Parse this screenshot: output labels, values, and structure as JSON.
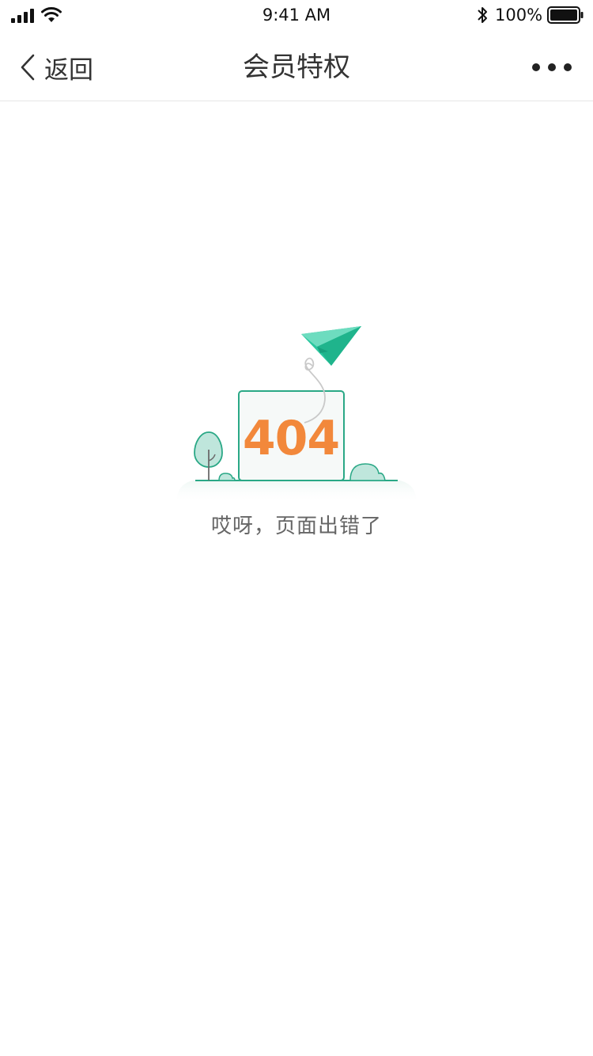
{
  "status_bar": {
    "time": "9:41 AM",
    "battery_percent": "100%",
    "icons": [
      "signal-icon",
      "wifi-icon",
      "bluetooth-icon",
      "battery-icon"
    ],
    "battery_level": 1.0
  },
  "nav": {
    "back_label": "返回",
    "title": "会员特权",
    "more_icon": "more-dots-icon",
    "back_icon": "chevron-left-icon"
  },
  "error": {
    "code": "404",
    "message": "哎呀，页面出错了"
  },
  "colors": {
    "accent_green": "#2bc79f",
    "code_orange": "#f2883b",
    "text_primary": "#333333",
    "text_secondary": "#666666"
  }
}
